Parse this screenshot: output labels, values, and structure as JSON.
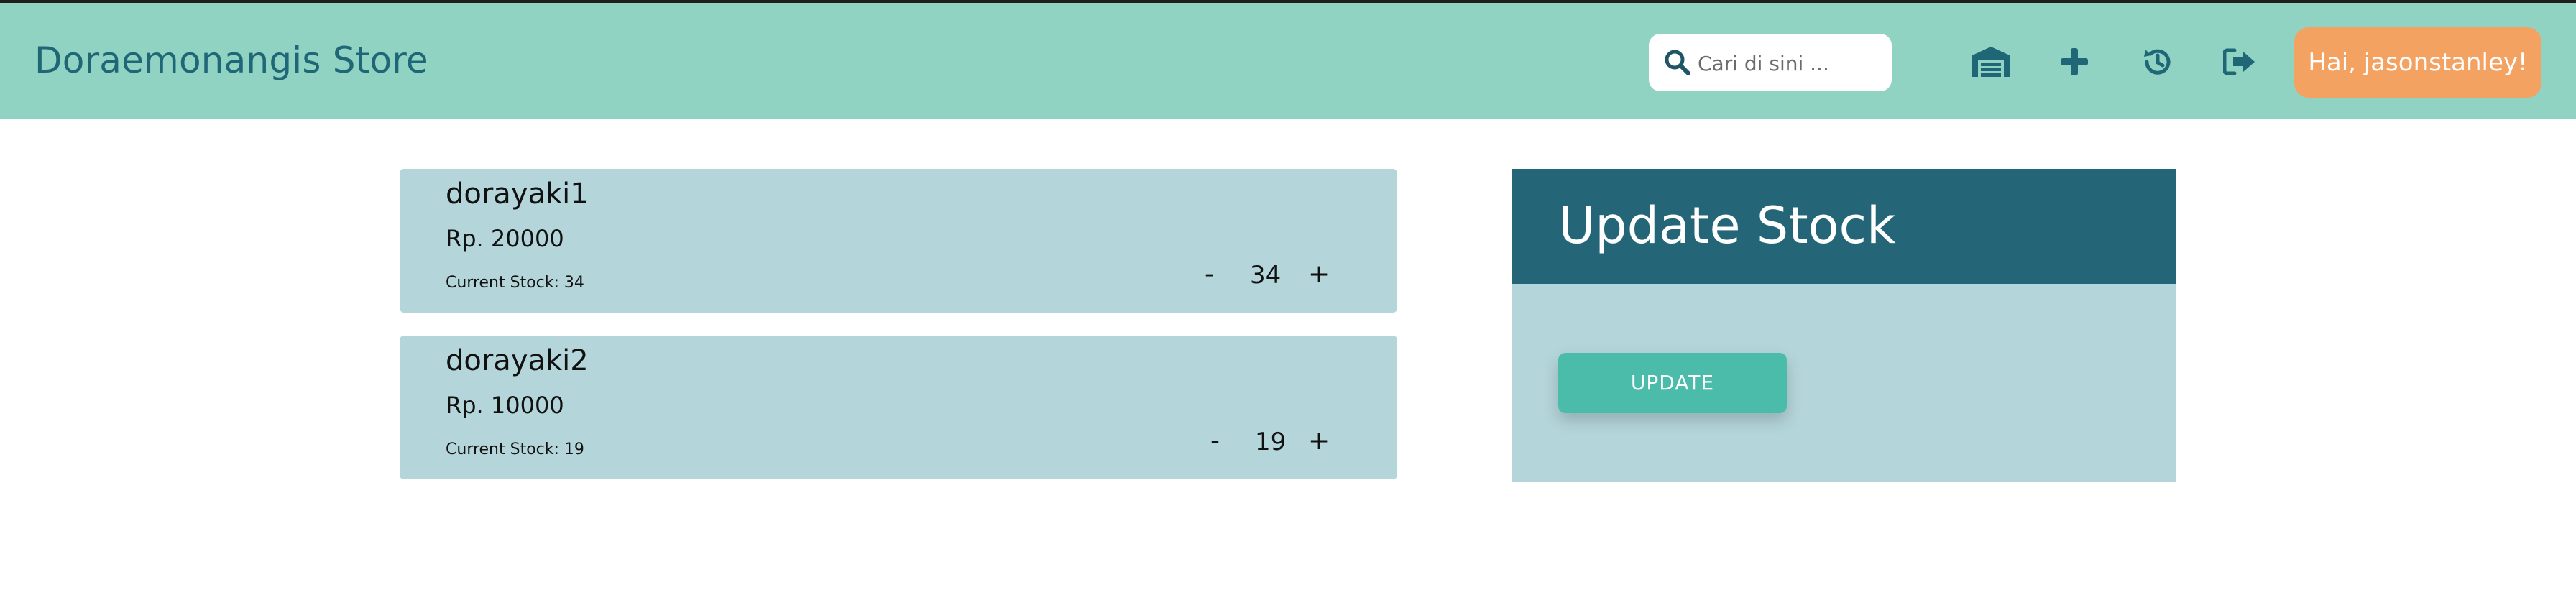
{
  "navbar": {
    "brand": "Doraemonangis Store",
    "search_placeholder": "Cari di sini ...",
    "greeting": "Hai, jasonstanley!",
    "icons": [
      "warehouse-icon",
      "plus-icon",
      "history-icon",
      "logout-icon"
    ]
  },
  "items": [
    {
      "name": "dorayaki1",
      "price": "Rp. 20000",
      "current_stock": "Current Stock: 34",
      "minus": "-",
      "quantity": "34",
      "plus": "+"
    },
    {
      "name": "dorayaki2",
      "price": "Rp. 10000",
      "current_stock": "Current Stock: 19",
      "minus": "-",
      "quantity": "19",
      "plus": "+"
    }
  ],
  "panel": {
    "title": "Update Stock",
    "update_label": "UPDATE"
  },
  "colors": {
    "navbar_bg": "#90d3c2",
    "brand_text": "#1f6677",
    "greeting_bg": "#f4a261",
    "card_bg": "#b4d5da",
    "panel_header_bg": "#246678",
    "update_button_bg": "#4bbcaa"
  }
}
